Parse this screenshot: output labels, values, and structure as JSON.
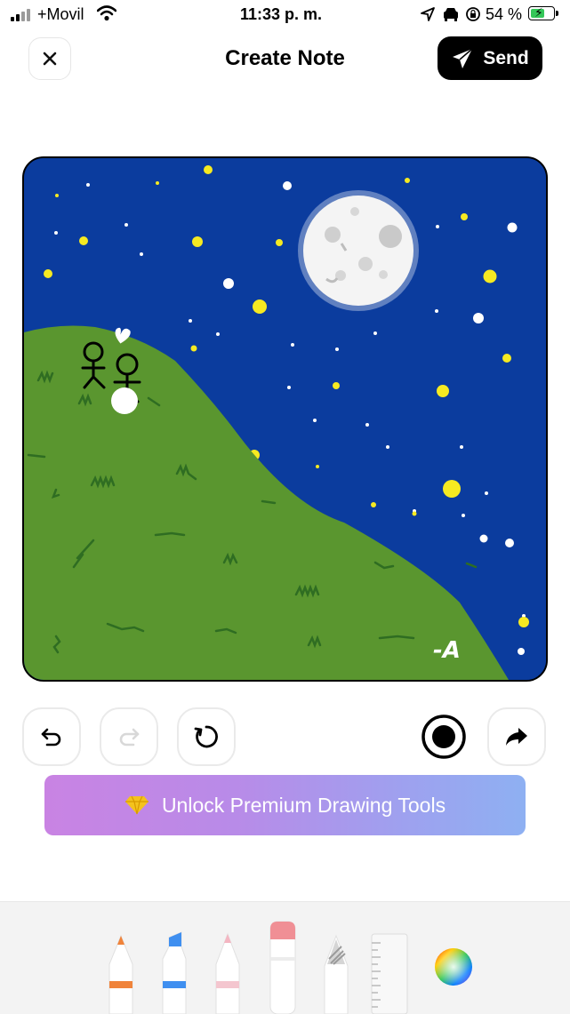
{
  "status_bar": {
    "carrier": "+Movil",
    "time": "11:33 p. m.",
    "battery_percent": "54 %",
    "battery_level": 0.54,
    "icons": [
      "signal-icon",
      "wifi-icon",
      "location-arrow-icon",
      "car-icon",
      "rotation-lock-icon",
      "battery-charging-icon"
    ]
  },
  "header": {
    "title": "Create Note",
    "send_label": "Send",
    "close_icon": "close-icon",
    "send_icon": "paper-plane-icon"
  },
  "drawing": {
    "signature": "-A",
    "colors": {
      "sky": "#0b3c9e",
      "hill": "#5a962f",
      "grass_strokes": "#2f6d22",
      "star_yellow": "#f6ea21",
      "moon": "#f0f0f0"
    }
  },
  "toolbar": {
    "undo_icon": "undo-icon",
    "redo_icon": "redo-icon",
    "reset_icon": "reset-icon",
    "record_icon": "record-icon",
    "share_icon": "share-arrow-icon"
  },
  "premium": {
    "label": "Unlock Premium Drawing Tools",
    "icon": "diamond-icon"
  },
  "tools_tray": {
    "tools": [
      {
        "name": "pen",
        "tip_color": "#f0833a"
      },
      {
        "name": "marker",
        "tip_color": "#3f8ff0"
      },
      {
        "name": "pencil",
        "tip_color": "#f4b6c2"
      },
      {
        "name": "eraser",
        "tip_color": "#f08f95"
      },
      {
        "name": "lasso",
        "tip_color": "#bdbdbd"
      },
      {
        "name": "ruler",
        "tip_color": "#e0e0e0"
      },
      {
        "name": "color-picker",
        "tip_color": "rainbow"
      }
    ]
  }
}
